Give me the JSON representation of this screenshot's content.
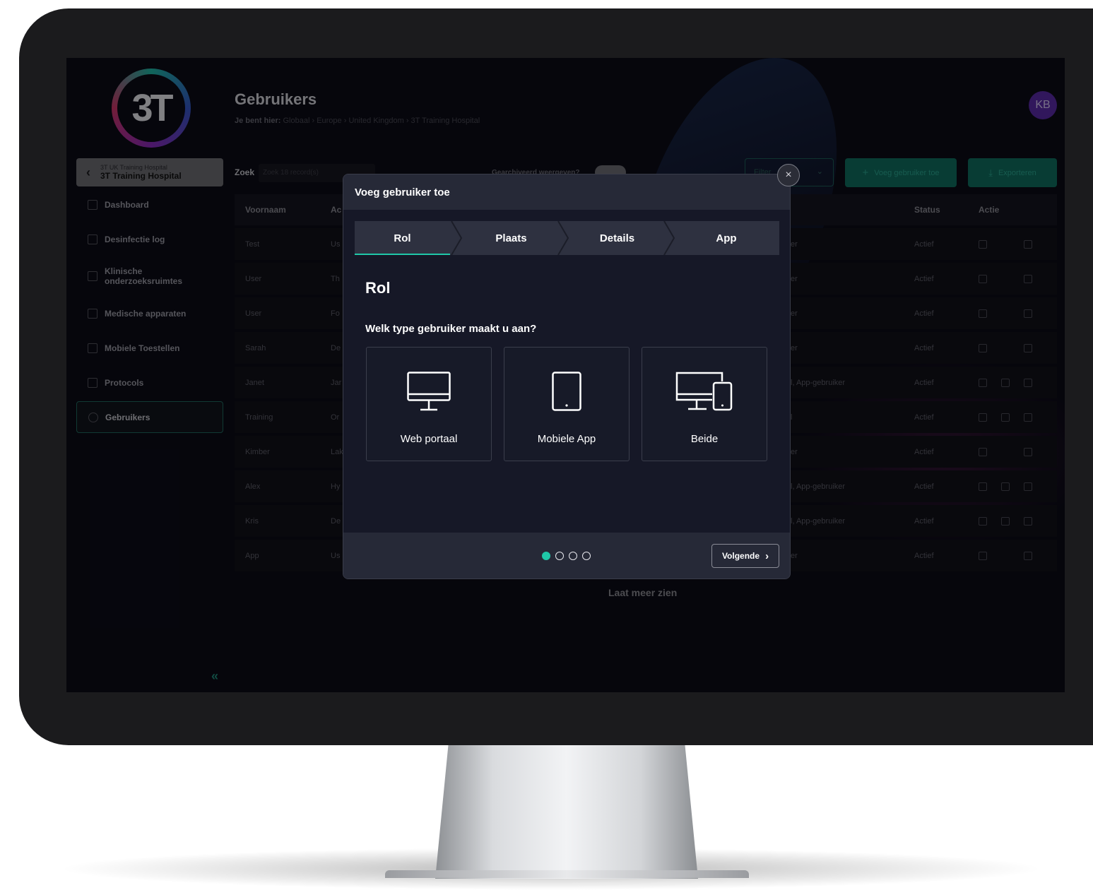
{
  "app": {
    "logo_text": "3T",
    "page_title": "Gebruikers",
    "breadcrumb": [
      "Je bent hier:",
      "Globaal",
      "Europe",
      "United Kingdom",
      "3T Training Hospital"
    ],
    "avatar_initials": "KB"
  },
  "sidebar": {
    "site_line1": "3T UK Training Hospital",
    "site_line2": "3T Training Hospital",
    "items": [
      {
        "label": "Dashboard"
      },
      {
        "label": "Desinfectie log"
      },
      {
        "label": "Klinische onderzoeksruimtes"
      },
      {
        "label": "Medische apparaten"
      },
      {
        "label": "Mobiele Toestellen"
      },
      {
        "label": "Protocols"
      },
      {
        "label": "Gebruikers",
        "active": true
      }
    ],
    "collapse_glyph": "«"
  },
  "toolbar": {
    "search_label": "Zoek",
    "search_placeholder": "Zoek 18 record(s)",
    "toggle_label": "Gearchiveerd weergeven?",
    "filter_label": "Filter",
    "add_label": "Voeg gebruiker toe",
    "export_label": "Exporteren"
  },
  "table": {
    "headers": {
      "first": "Voornaam",
      "second": "Ac",
      "status": "Status",
      "action": "Actie"
    },
    "rows": [
      {
        "first": "Test",
        "a": "Us",
        "role": "er",
        "status": "Actief",
        "mail": false
      },
      {
        "first": "User",
        "a": "Th",
        "role": "er",
        "status": "Actief",
        "mail": false
      },
      {
        "first": "User",
        "a": "Fo",
        "role": "er",
        "status": "Actief",
        "mail": false
      },
      {
        "first": "Sarah",
        "a": "De",
        "role": "er",
        "status": "Actief",
        "mail": false
      },
      {
        "first": "Janet",
        "a": "Jar",
        "role": "l, App-gebruiker",
        "status": "Actief",
        "mail": true
      },
      {
        "first": "Training",
        "a": "Or",
        "role": "l",
        "status": "Actief",
        "mail": true
      },
      {
        "first": "Kimber",
        "a": "Lak",
        "role": "er",
        "status": "Actief",
        "mail": false
      },
      {
        "first": "Alex",
        "a": "Hy",
        "role": "l, App-gebruiker",
        "status": "Actief",
        "mail": true
      },
      {
        "first": "Kris",
        "a": "De",
        "role": "l, App-gebruiker",
        "status": "Actief",
        "mail": true
      },
      {
        "first": "App",
        "a": "Us",
        "role": "er",
        "status": "Actief",
        "mail": false
      }
    ],
    "show_more": "Laat meer zien"
  },
  "modal": {
    "title": "Voeg gebruiker toe",
    "close_glyph": "×",
    "steps": [
      "Rol",
      "Plaats",
      "Details",
      "App"
    ],
    "active_step": 0,
    "section_title": "Rol",
    "question": "Welk type gebruiker maakt u aan?",
    "options": [
      {
        "label": "Web portaal",
        "icon": "monitor-icon"
      },
      {
        "label": "Mobiele App",
        "icon": "tablet-icon"
      },
      {
        "label": "Beide",
        "icon": "devices-icon"
      }
    ],
    "pager_total": 4,
    "pager_current": 1,
    "next_label": "Volgende",
    "accent_color": "#1fc7a8"
  }
}
